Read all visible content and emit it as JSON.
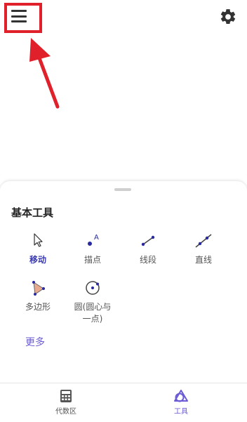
{
  "top_bar": {
    "menu_icon": "hamburger-menu-icon",
    "settings_icon": "gear-icon"
  },
  "annotation": {
    "highlight_color": "#e0202a"
  },
  "tools_panel": {
    "title": "基本工具",
    "tools": [
      {
        "label": "移动",
        "icon": "move-cursor-icon",
        "active": true
      },
      {
        "label": "描点",
        "icon": "point-icon",
        "active": false
      },
      {
        "label": "线段",
        "icon": "segment-icon",
        "active": false
      },
      {
        "label": "直线",
        "icon": "line-icon",
        "active": false
      },
      {
        "label": "多边形",
        "icon": "polygon-icon",
        "active": false
      },
      {
        "label": "圆(圆心与一点)",
        "icon": "circle-center-point-icon",
        "active": false
      }
    ],
    "more_label": "更多"
  },
  "bottom_nav": {
    "items": [
      {
        "label": "代数区",
        "icon": "calculator-icon",
        "active": false
      },
      {
        "label": "工具",
        "icon": "tools-shapes-icon",
        "active": true
      }
    ]
  },
  "colors": {
    "accent": "#6b5bd6",
    "active_label": "#3c3cb0"
  }
}
